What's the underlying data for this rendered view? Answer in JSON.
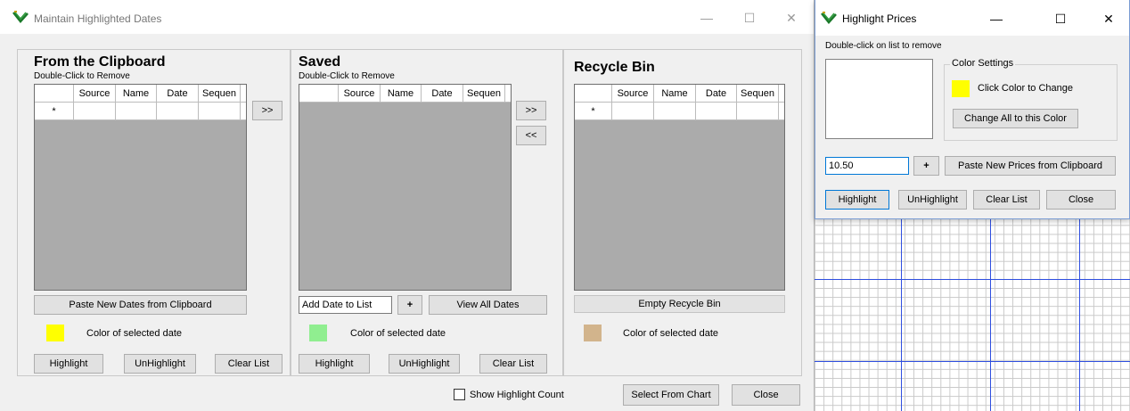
{
  "colors": {
    "yellow": "#ffff00",
    "green": "#90ee90",
    "tan": "#d2b48c",
    "chart_line": "#2f4fe0"
  },
  "main": {
    "title": "Maintain Highlighted Dates",
    "minimize": "—",
    "maximize": "☐",
    "close": "✕"
  },
  "clipboard": {
    "title": "From the Clipboard",
    "subtitle": "Double-Click to Remove",
    "columns": [
      "",
      "Source",
      "Name",
      "Date",
      "Sequen"
    ],
    "new_row_marker": "*",
    "move_right_label": ">>",
    "paste_label": "Paste New Dates from Clipboard",
    "color_label": "Color of selected date",
    "highlight_label": "Highlight",
    "unhighlight_label": "UnHighlight",
    "clear_label": "Clear List"
  },
  "saved": {
    "title": "Saved",
    "subtitle": "Double-Click to Remove",
    "columns": [
      "",
      "Source",
      "Name",
      "Date",
      "Sequen"
    ],
    "move_right_label": ">>",
    "move_left_label": "<<",
    "add_date_value": "Add Date to List",
    "plus_label": "+",
    "view_all_label": "View All Dates",
    "color_label": "Color of selected date",
    "highlight_label": "Highlight",
    "unhighlight_label": "UnHighlight",
    "clear_label": "Clear List"
  },
  "recycle": {
    "title": "Recycle Bin",
    "columns": [
      "",
      "Source",
      "Name",
      "Date",
      "Sequen"
    ],
    "new_row_marker": "*",
    "empty_label": "Empty Recycle Bin",
    "color_label": "Color of selected date"
  },
  "footer": {
    "show_count_label": "Show Highlight Count",
    "select_from_chart_label": "Select From Chart",
    "close_label": "Close"
  },
  "prices": {
    "title": "Highlight Prices",
    "minimize": "—",
    "maximize": "☐",
    "close": "✕",
    "instruction": "Double-click on list to remove",
    "color_settings_label": "Color Settings",
    "click_color_label": "Click Color to Change",
    "change_all_label": "Change All to this Color",
    "price_value": "10.50",
    "plus_label": "+",
    "paste_label": "Paste New Prices from Clipboard",
    "highlight_label": "Highlight",
    "unhighlight_label": "UnHighlight",
    "clear_label": "Clear List",
    "close_label": "Close"
  }
}
